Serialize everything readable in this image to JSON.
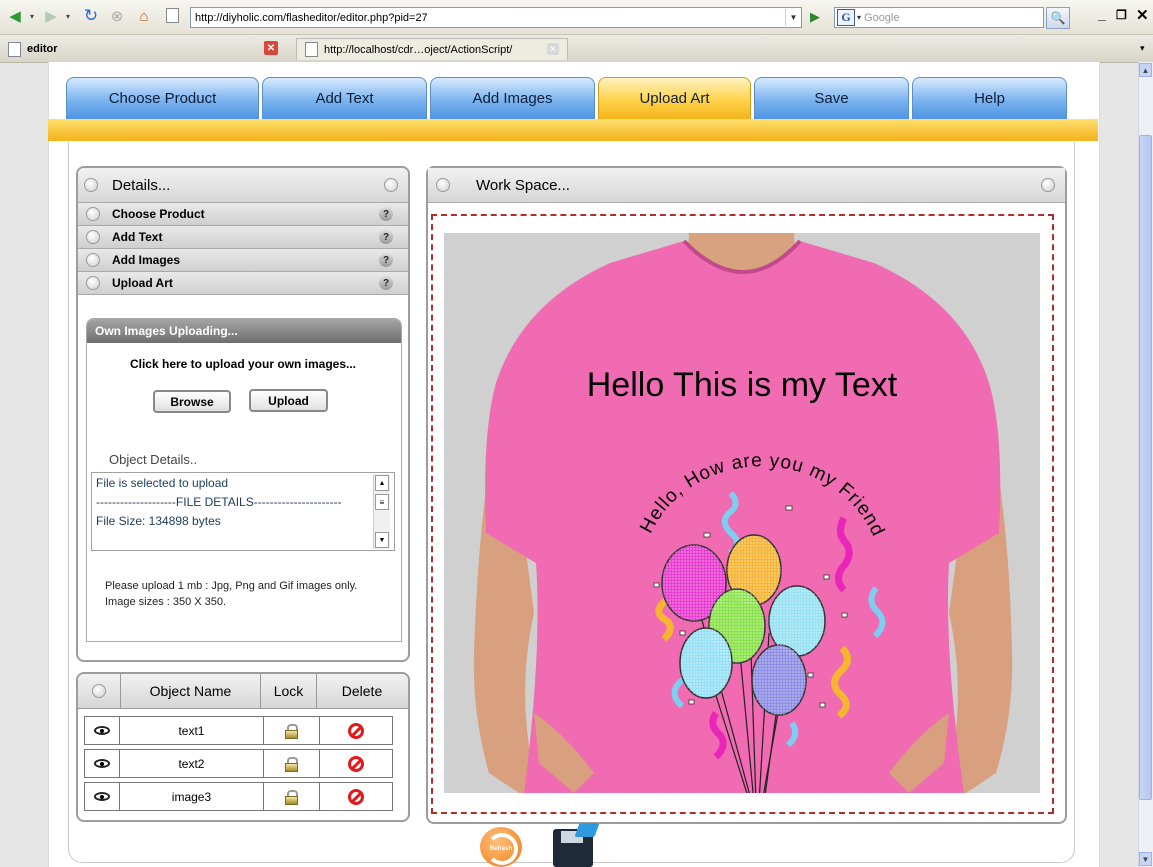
{
  "browser": {
    "url": "http://diyholic.com/flasheditor/editor.php?pid=27",
    "search_placeholder": "Google",
    "tabs": [
      {
        "label": "editor",
        "active": true
      },
      {
        "label": "http://localhost/cdr…oject/ActionScript/",
        "active": false
      }
    ]
  },
  "nav": {
    "tabs": [
      {
        "label": "Choose Product"
      },
      {
        "label": "Add Text"
      },
      {
        "label": "Add Images"
      },
      {
        "label": "Upload Art",
        "active": true
      },
      {
        "label": "Save"
      },
      {
        "label": "Help"
      }
    ]
  },
  "details": {
    "title": "Details...",
    "sections": [
      "Choose Product",
      "Add Text",
      "Add Images",
      "Upload Art"
    ],
    "upload": {
      "header": "Own Images Uploading...",
      "instruction": "Click here to upload your own images...",
      "browse_label": "Browse",
      "upload_label": "Upload",
      "object_details_label": "Object Details..",
      "details_lines": [
        "File is selected to upload",
        "--------------------FILE DETAILS----------------------",
        "File Size: 134898 bytes"
      ],
      "note_line1": "Please upload 1 mb : Jpg, Png and Gif images only.",
      "note_line2": "Image sizes : 350 X 350."
    }
  },
  "objects": {
    "headers": {
      "name": "Object Name",
      "lock": "Lock",
      "delete": "Delete"
    },
    "rows": [
      {
        "name": "text1"
      },
      {
        "name": "text2"
      },
      {
        "name": "image3"
      }
    ]
  },
  "workspace": {
    "title": "Work Space...",
    "shirt_color": "#f06bb2",
    "headline": "Hello This is my Text",
    "curved_text": "Hello, How are you my Friend"
  },
  "footer": {
    "refresh_icon_text": "Refresh"
  },
  "colors": {
    "nav_active": "#ffd24a",
    "nav_default": "#7bb3ef",
    "band": "#f5b21c",
    "dash": "#b32d2d"
  }
}
